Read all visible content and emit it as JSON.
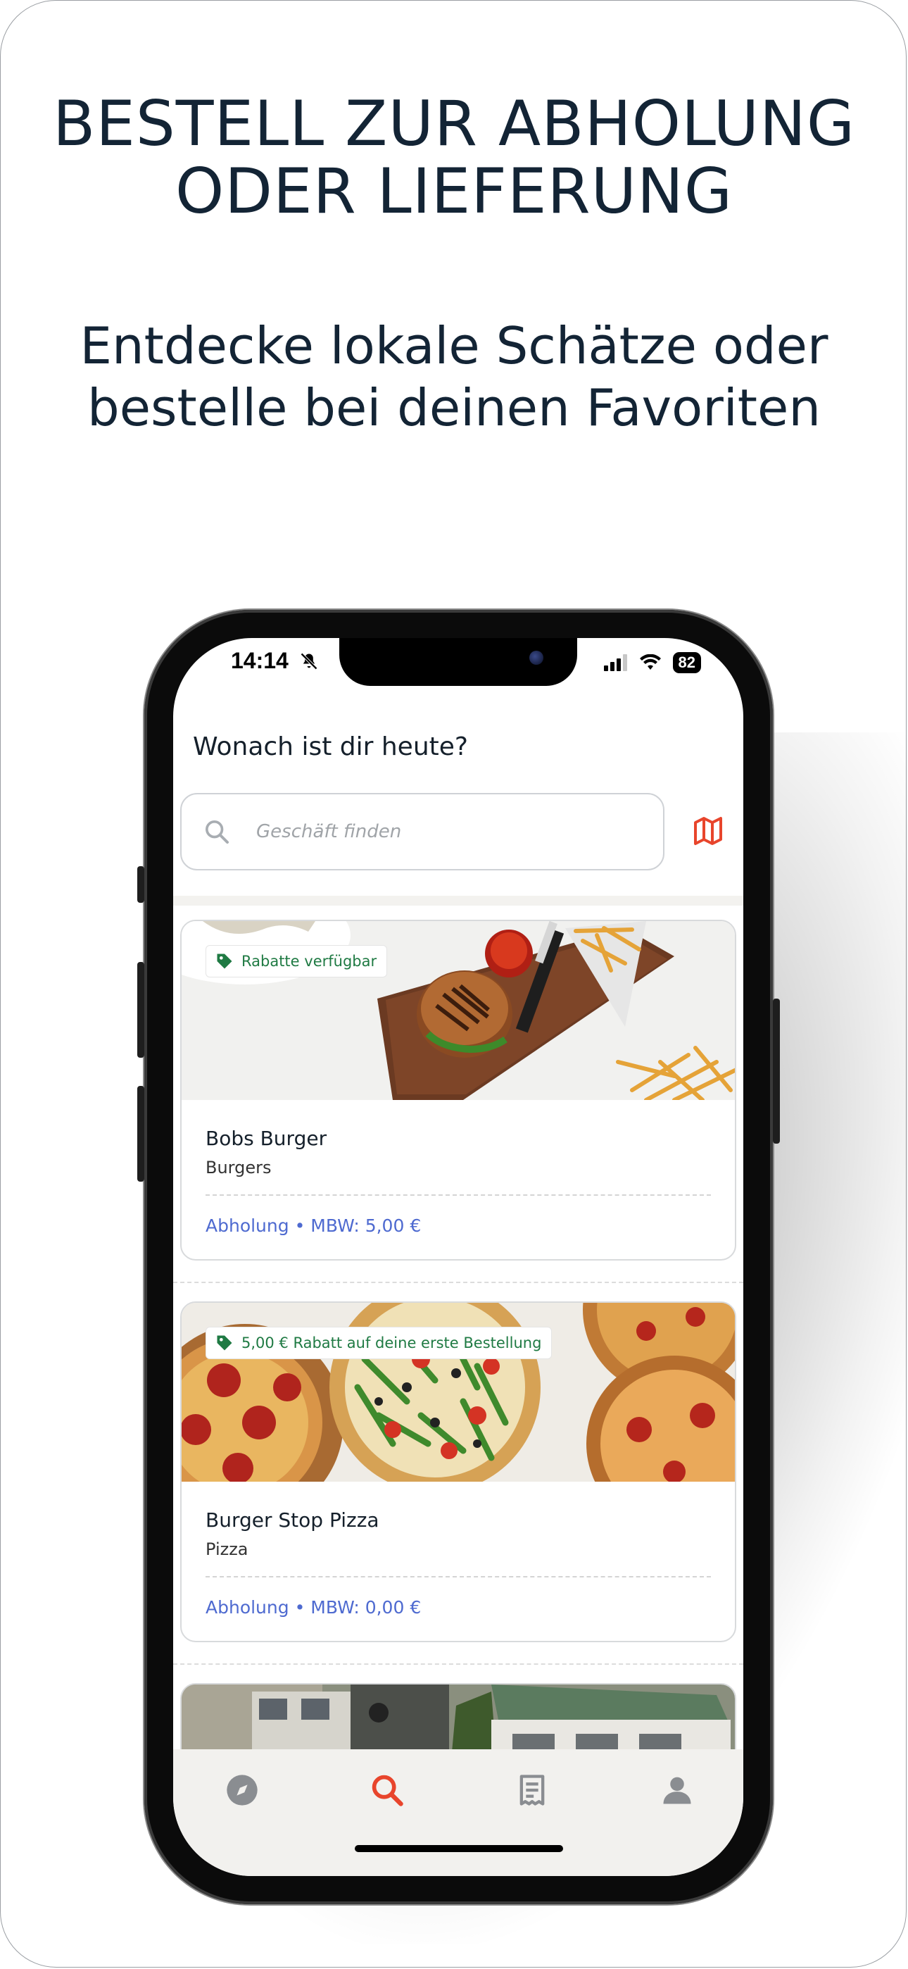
{
  "marketing": {
    "headline_line1": "BESTELL ZUR ABHOLUNG",
    "headline_line2": "ODER LIEFERUNG",
    "sub_line1": "Entdecke lokale Schätze oder",
    "sub_line2": "bestelle bei deinen Favoriten"
  },
  "status_bar": {
    "time": "14:14",
    "battery": "82",
    "icons": [
      "bell-slash-icon",
      "signal-icon",
      "wifi-icon",
      "battery-icon"
    ]
  },
  "app": {
    "greeting": "Wonach ist dir heute?",
    "search": {
      "placeholder": "Geschäft finden"
    },
    "map_button_icon": "map-icon",
    "accent_color": "#e8452c",
    "badge_color": "#1f7a43",
    "meta_color": "#4e6ad0"
  },
  "stores": [
    {
      "name": "Bobs Burger",
      "category": "Burgers",
      "badge": "Rabatte verfügbar",
      "meta": "Abholung • MBW: 5,00 €",
      "image": "burger-photo"
    },
    {
      "name": "Burger Stop Pizza",
      "category": "Pizza",
      "badge": "5,00 € Rabatt auf deine erste Bestellung",
      "meta": "Abholung • MBW: 0,00 €",
      "image": "pizza-photo"
    }
  ],
  "tabbar": {
    "tabs": [
      {
        "icon": "compass-icon",
        "active": false
      },
      {
        "icon": "search-icon",
        "active": true
      },
      {
        "icon": "receipt-icon",
        "active": false
      },
      {
        "icon": "user-icon",
        "active": false
      }
    ]
  }
}
